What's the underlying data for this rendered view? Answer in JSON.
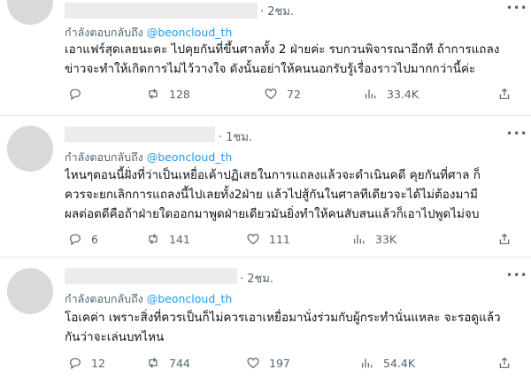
{
  "tweets": [
    {
      "time": "· 2ชม.",
      "replying_prefix": "กำลังตอบกลับถึง",
      "replying_handle": "@beoncloud_th",
      "lines": [
        "เอาแฟร์สุดเลยนะคะ ไปคุยกันที่ขึ้นศาลทั้ง 2 ฝ่ายค่ะ รบกวนพิจารณาอีกที ถ้าการแถลง",
        "ข่าวจะทำให้เกิดการไม่ไว้วางใจ ดังนั้นอย่าให้คนนอกรับรู้เรื่องราวไปมากกว่านี้ค่ะ"
      ],
      "replies": "",
      "retweets": "128",
      "likes": "72",
      "views": "33.4K"
    },
    {
      "time": "· 1ชม.",
      "replying_prefix": "กำลังตอบกลับถึง",
      "replying_handle": "@beoncloud_th",
      "lines": [
        "ไหนๆตอนนี้ฝั่งที่ว่าเป็นเหยื่อเค้าปฏิเสธในการแถลงแล้วจะดำเนินคดี คุยกันที่ศาล ก็",
        "ควรจะยกเลิกการแถลงนี้ไปเลยทั้ง2ฝ่าย แล้วไปสู้กันในศาลทีเดียวจะได้ไม่ต้องมามี",
        "ผลต่อตดีคือถ้าฝ่ายใดออกมาพูดฝ่ายเดียวมันยิ่งทำให้คนสับสนแล้วก็เอาไปพูดไม่จบ"
      ],
      "replies": "6",
      "retweets": "141",
      "likes": "111",
      "views": "33K"
    },
    {
      "time": "· 2ชม.",
      "replying_prefix": "กำลังตอบกลับถึง",
      "replying_handle": "@beoncloud_th",
      "lines": [
        "โอเคค่า เพราะสิ่งที่ควรเป็นก็ไม่ควรเอาเหยื่อมานั่งร่วมกับผู้กระทำนั่นแหละ จะรอดูแล้ว",
        "กันว่าจะเล่นบทไหน"
      ],
      "replies": "12",
      "retweets": "744",
      "likes": "197",
      "views": "54.4K"
    }
  ],
  "icons": {
    "reply": "reply-icon",
    "retweet": "retweet-icon",
    "like": "heart-icon",
    "views": "views-icon",
    "share": "share-icon",
    "more": "more-icon"
  }
}
